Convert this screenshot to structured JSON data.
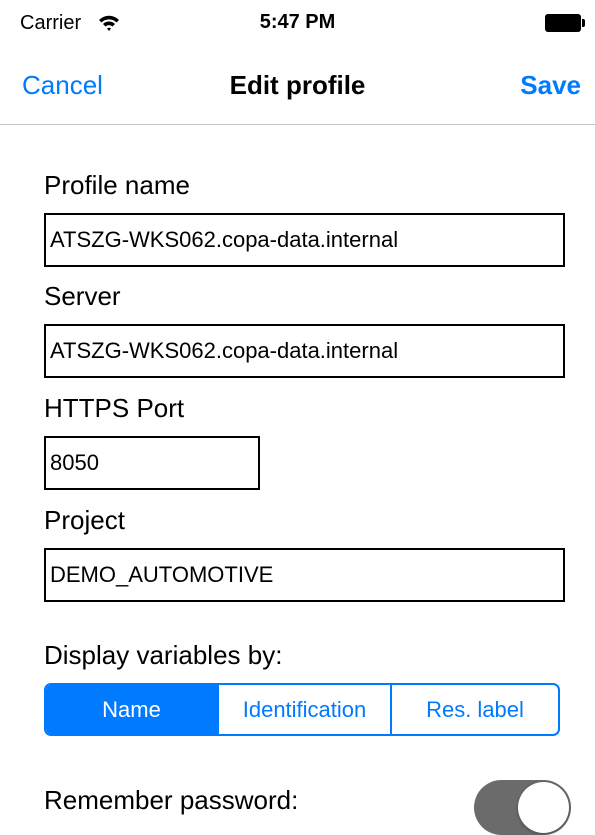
{
  "status_bar": {
    "carrier": "Carrier",
    "wifi_icon": "wifi-icon",
    "time": "5:47 PM",
    "battery_icon": "battery-full-icon"
  },
  "nav": {
    "cancel_label": "Cancel",
    "title": "Edit profile",
    "save_label": "Save"
  },
  "form": {
    "profile_name": {
      "label": "Profile name",
      "value": "ATSZG-WKS062.copa-data.internal"
    },
    "server": {
      "label": "Server",
      "value": "ATSZG-WKS062.copa-data.internal"
    },
    "https_port": {
      "label": "HTTPS Port",
      "value": "8050"
    },
    "project": {
      "label": "Project",
      "value": "DEMO_AUTOMOTIVE"
    },
    "display_by": {
      "label": "Display variables by:",
      "options": [
        "Name",
        "Identification",
        "Res. label"
      ],
      "selected": "Name"
    },
    "remember_password": {
      "label": "Remember password:",
      "enabled": true
    }
  },
  "colors": {
    "accent": "#007aff",
    "toggle_track": "#6b6b6b",
    "divider": "#c8c7cc"
  }
}
